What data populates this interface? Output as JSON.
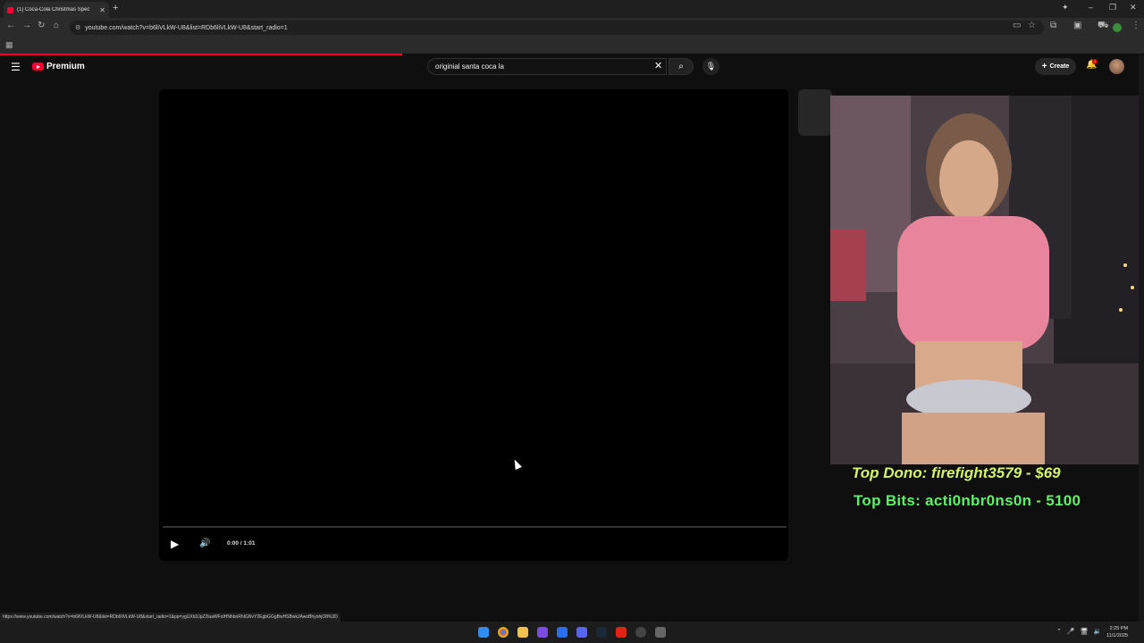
{
  "browser": {
    "tab_title": "(1) Coca-Cola Christmas Spec",
    "url": "youtube.com/watch?v=b6liVLkW-U8&list=RDb6liVLkW-U8&start_radio=1",
    "status_url": "https://www.youtube.com/watch?v=b6liVLkW-U8&list=RDb6liVLkW-U8&start_radio=1&pp=ygUXb3JpZ2luaWFsIHNhbnRhIGNvY2EgbGGgBwHSBwkJAwoBhyohjO8%3D"
  },
  "youtube": {
    "logo_text": "Premium",
    "search_query": "originial santa coca la",
    "create_label": "Create",
    "notification_count": "1"
  },
  "player": {
    "time": "0:00 / 1:01",
    "progress": 0
  },
  "overlay": {
    "top_dono": "Top Dono: firefight3579 - $69",
    "top_bits": "Top Bits: acti0nbr0ns0n - 5100"
  },
  "taskbar": {
    "time": "2:25 PM",
    "date": "11/1/2025"
  },
  "colors": {
    "accent": "#ff0033",
    "dono": "#d4f46c",
    "bits": "#5ff06a"
  }
}
